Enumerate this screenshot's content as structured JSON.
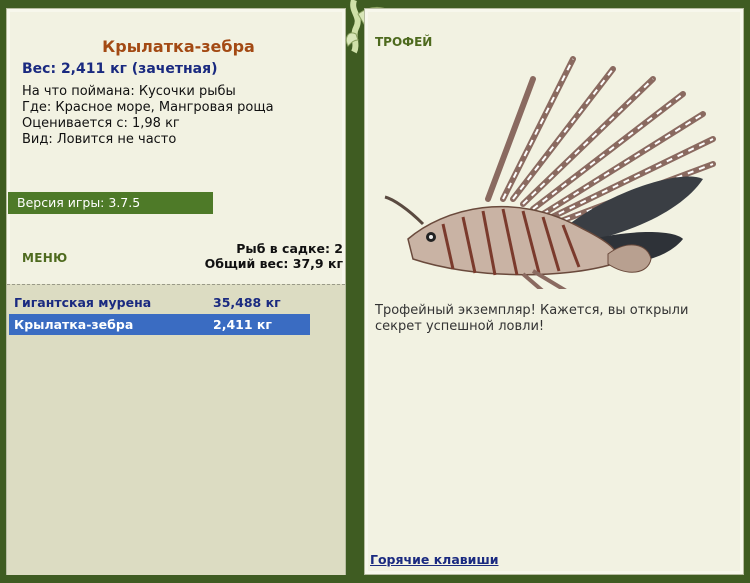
{
  "fish": {
    "name": "Крылатка-зебра",
    "weight_line": "Вес: 2,411 кг (зачетная)",
    "bait_line": "На что поймана: Кусочки рыбы",
    "location_line": "Где: Красное море, Мангровая роща",
    "value_line": "Оценивается с: 1,98 кг",
    "frequency_line": "Вид: Ловится не часто"
  },
  "version_label": "Версия игры: 3.7.5",
  "menu_label": "МЕНЮ",
  "stats": {
    "fish_count": "Рыб в садке: 2",
    "total_weight": "Общий вес: 37,9 кг"
  },
  "catch_list": [
    {
      "name": "Гигантская мурена",
      "weight": "35,488 кг",
      "selected": false
    },
    {
      "name": "Крылатка-зебра",
      "weight": "2,411 кг",
      "selected": true
    }
  ],
  "trophy": {
    "label": "ТРОФЕЙ",
    "message": "Трофейный экземпляр! Кажется, вы открыли секрет успешной ловли!",
    "image_icon": "lionfish-image"
  },
  "hotkeys_label": "Горячие клавиши",
  "colors": {
    "background": "#3f5c22",
    "panel": "#f2f2e2",
    "fish_name": "#a34a14",
    "link_blue": "#1a2a80",
    "selected_row": "#3a6cc2",
    "version_bar": "#4e7a28"
  }
}
